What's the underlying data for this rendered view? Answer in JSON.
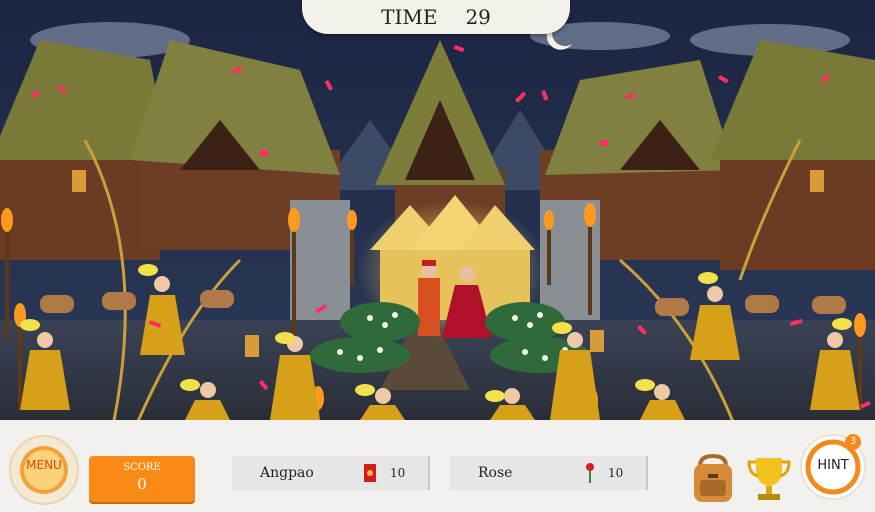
{
  "timer": {
    "label": "TIME",
    "value": "29"
  },
  "menu": {
    "label": "MENU"
  },
  "score": {
    "label": "SCORE",
    "value": "0"
  },
  "items": [
    {
      "name": "Angpao",
      "count": "10",
      "icon": "angpao-icon"
    },
    {
      "name": "Rose",
      "count": "10",
      "icon": "rose-icon"
    }
  ],
  "tools": {
    "bag": "backpack-icon",
    "trophy": "trophy-icon"
  },
  "hint": {
    "label": "HINT",
    "badge": "3"
  },
  "colors": {
    "accent": "#f98a16",
    "hud_bg": "#f3f1ee",
    "sky": "#1b2540",
    "confetti": "#ff2e63"
  }
}
